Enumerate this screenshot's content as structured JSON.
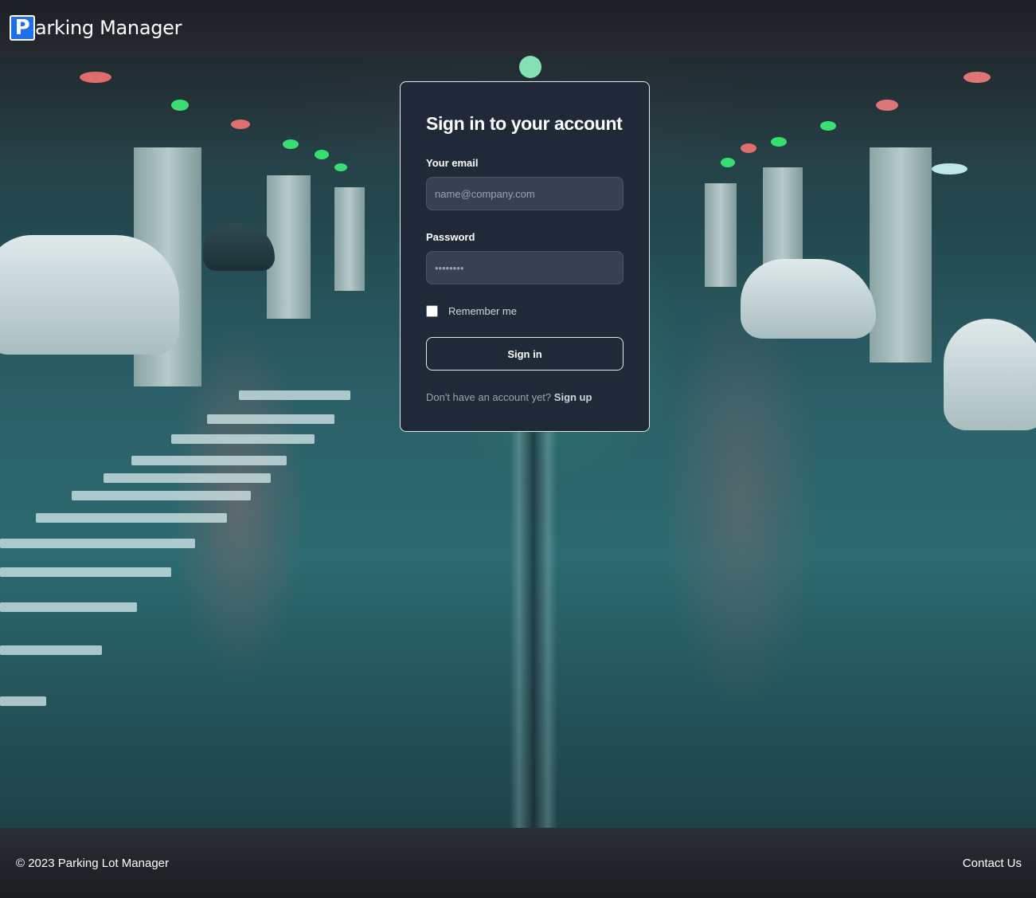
{
  "navbar": {
    "brand_initial": "P",
    "brand_rest": "arking Manager"
  },
  "login": {
    "title": "Sign in to your account",
    "email_label": "Your email",
    "email_placeholder": "name@company.com",
    "password_label": "Password",
    "password_value": "••••••••",
    "remember_label": "Remember me",
    "remember_checked": false,
    "signin_label": "Sign in",
    "signup_prompt": "Don't have an account yet?",
    "signup_link": "Sign up"
  },
  "footer": {
    "copyright": "© 2023 Parking Lot Manager",
    "contact_link": "Contact Us"
  },
  "colors": {
    "brand_blue": "#1e6fe8",
    "card_bg": "#1f2937",
    "input_bg": "#374151"
  }
}
